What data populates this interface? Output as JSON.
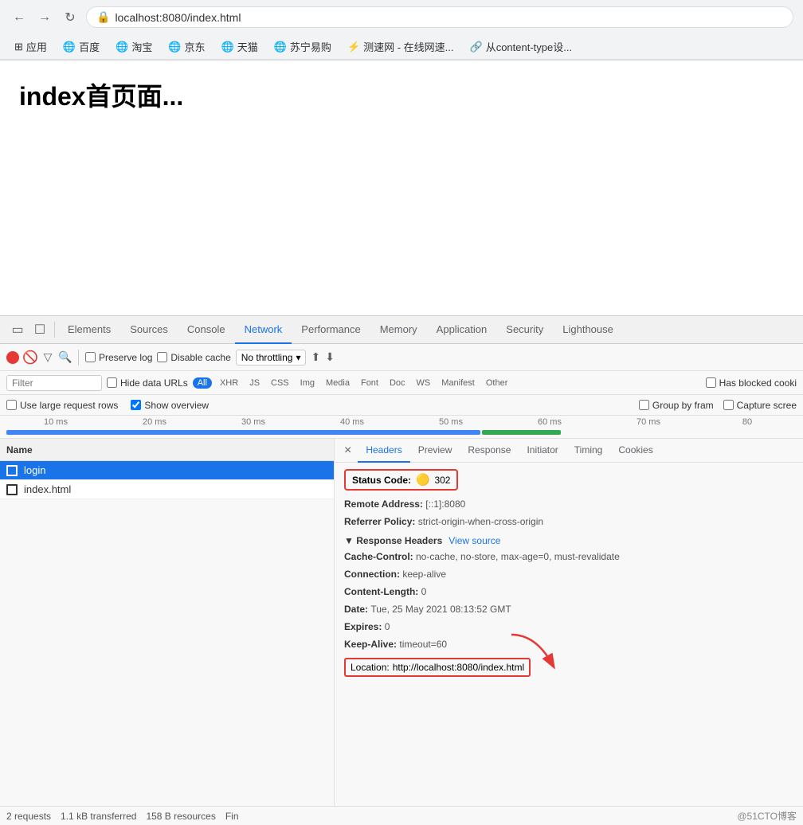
{
  "browser": {
    "back_btn": "←",
    "forward_btn": "→",
    "reload_btn": "↻",
    "url": "localhost:8080/index.html",
    "bookmarks": [
      {
        "label": "应用",
        "icon": "⊞"
      },
      {
        "label": "百度",
        "icon": "🌐"
      },
      {
        "label": "淘宝",
        "icon": "🌐"
      },
      {
        "label": "京东",
        "icon": "🌐"
      },
      {
        "label": "天猫",
        "icon": "🌐"
      },
      {
        "label": "苏宁易购",
        "icon": "🌐"
      },
      {
        "label": "测速网 - 在线网速...",
        "icon": "⚡"
      },
      {
        "label": "从content-type设...",
        "icon": "🔗"
      }
    ]
  },
  "page": {
    "title": "index首页面..."
  },
  "devtools": {
    "tabs": [
      {
        "label": "Elements",
        "active": false
      },
      {
        "label": "Sources",
        "active": false
      },
      {
        "label": "Console",
        "active": false
      },
      {
        "label": "Network",
        "active": true
      },
      {
        "label": "Performance",
        "active": false
      },
      {
        "label": "Memory",
        "active": false
      },
      {
        "label": "Application",
        "active": false
      },
      {
        "label": "Security",
        "active": false
      },
      {
        "label": "Lighthouse",
        "active": false
      }
    ],
    "network": {
      "toolbar": {
        "preserve_log": "Preserve log",
        "disable_cache": "Disable cache",
        "throttle": "No throttling",
        "throttle_arrow": "▾"
      },
      "filter": {
        "placeholder": "Filter",
        "hide_data_urls": "Hide data URLs",
        "all_tag": "All",
        "types": [
          "XHR",
          "JS",
          "CSS",
          "Img",
          "Media",
          "Font",
          "Doc",
          "WS",
          "Manifest",
          "Other"
        ],
        "has_blocked": "Has blocked cooki",
        "use_large": "Use large request rows",
        "show_overview": "Show overview",
        "group_by_frame": "Group by fram",
        "capture_screen": "Capture scree"
      },
      "timeline": {
        "labels": [
          "10 ms",
          "20 ms",
          "30 ms",
          "40 ms",
          "50 ms",
          "60 ms",
          "70 ms",
          "80"
        ]
      },
      "requests": {
        "header": "Name",
        "items": [
          {
            "name": "login",
            "selected": true
          },
          {
            "name": "index.html",
            "selected": false
          }
        ]
      },
      "details": {
        "close": "×",
        "tabs": [
          "Headers",
          "Preview",
          "Response",
          "Initiator",
          "Timing",
          "Cookies"
        ],
        "active_tab": "Headers",
        "status_code_label": "Status Code:",
        "status_code_dot": "🟡",
        "status_code_value": "302",
        "remote_address_label": "Remote Address:",
        "remote_address_value": "[::1]:8080",
        "referrer_policy_label": "Referrer Policy:",
        "referrer_policy_value": "strict-origin-when-cross-origin",
        "response_headers_label": "▼ Response Headers",
        "view_source": "View source",
        "headers": [
          {
            "key": "Cache-Control:",
            "val": "no-cache, no-store, max-age=0, must-revalidate"
          },
          {
            "key": "Connection:",
            "val": "keep-alive"
          },
          {
            "key": "Content-Length:",
            "val": "0"
          },
          {
            "key": "Date:",
            "val": "Tue, 25 May 2021 08:13:52 GMT"
          },
          {
            "key": "Expires:",
            "val": "0"
          },
          {
            "key": "Keep-Alive:",
            "val": "timeout=60"
          },
          {
            "key": "Location:",
            "val": "http://localhost:8080/index.html"
          }
        ]
      }
    },
    "status_bar": {
      "requests": "2 requests",
      "transferred": "1.1 kB transferred",
      "resources": "158 B resources",
      "fin": "Fin",
      "watermark": "@51CTO博客"
    }
  }
}
